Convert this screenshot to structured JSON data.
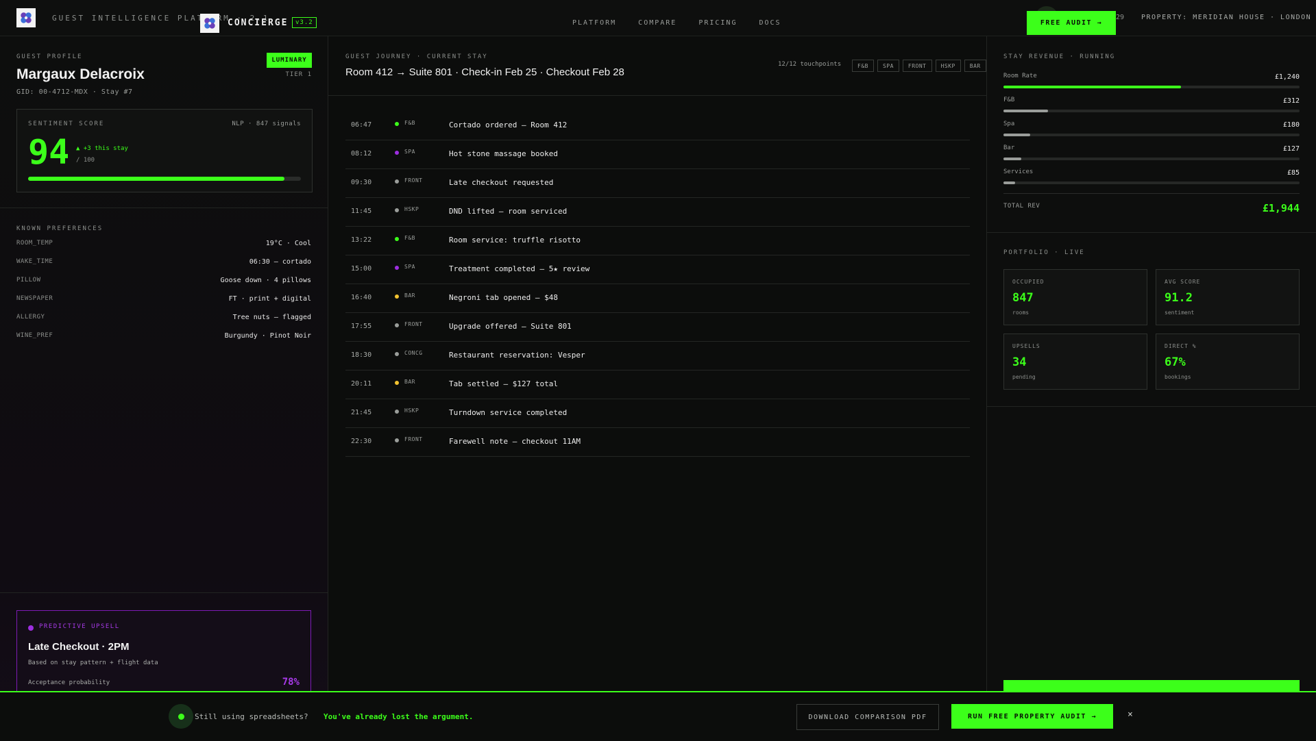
{
  "header": {
    "platform_title": "GUEST INTELLIGENCE PLATFORM · 2.1",
    "brand": "CONCIERGE",
    "version": "v3.2",
    "nav": [
      "PLATFORM",
      "COMPARE",
      "PRICING",
      "DOCS"
    ],
    "partial_number": "29",
    "property": "PROPERTY: MERIDIAN HOUSE · LONDON",
    "cta": "FREE AUDIT →"
  },
  "profile": {
    "eyebrow": "GUEST PROFILE",
    "name": "Margaux Delacroix",
    "gid": "GID: 00-4712-MDX · Stay #7",
    "tier_badge": "LUMINARY",
    "tier": "TIER 1",
    "sentiment": {
      "title": "SENTIMENT SCORE",
      "meta": "NLP · 847 signals",
      "score": "94",
      "delta": "▲ +3 this stay",
      "max": "/ 100",
      "progress": 0.94
    }
  },
  "preferences": {
    "eyebrow": "KNOWN PREFERENCES",
    "items": [
      {
        "key": "ROOM_TEMP",
        "value": "19°C · Cool"
      },
      {
        "key": "WAKE_TIME",
        "value": "06:30 — cortado"
      },
      {
        "key": "PILLOW",
        "value": "Goose down · 4 pillows"
      },
      {
        "key": "NEWSPAPER",
        "value": "FT · print + digital"
      },
      {
        "key": "ALLERGY",
        "value": "Tree nuts — flagged"
      },
      {
        "key": "WINE_PREF",
        "value": "Burgundy · Pinot Noir"
      }
    ]
  },
  "upsell": {
    "tag": "PREDICTIVE UPSELL",
    "title": "Late Checkout · 2PM",
    "desc": "Based on stay pattern + flight data",
    "prob_label": "Acceptance probability",
    "prob": "78%"
  },
  "journey": {
    "eyebrow": "GUEST JOURNEY · CURRENT STAY",
    "route_from": "Room 412",
    "route_arrow": "→",
    "route_to": "Suite 801 · Check-in Feb 25 · Checkout Feb 28",
    "touchpoints": "12/12 touchpoints",
    "filters": [
      "F&B",
      "SPA",
      "FRONT",
      "HSKP",
      "BAR"
    ],
    "category_colors": {
      "F&B": "#3cff1a",
      "SPA": "#9d2ee0",
      "FRONT": "#9a9d9a",
      "HSKP": "#9a9d9a",
      "BAR": "#f2c230",
      "CONCG": "#9a9d9a"
    },
    "events": [
      {
        "time": "06:47",
        "cat": "F&B",
        "text": "Cortado ordered — Room 412"
      },
      {
        "time": "08:12",
        "cat": "SPA",
        "text": "Hot stone massage booked"
      },
      {
        "time": "09:30",
        "cat": "FRONT",
        "text": "Late checkout requested"
      },
      {
        "time": "11:45",
        "cat": "HSKP",
        "text": "DND lifted — room serviced"
      },
      {
        "time": "13:22",
        "cat": "F&B",
        "text": "Room service: truffle risotto"
      },
      {
        "time": "15:00",
        "cat": "SPA",
        "text": "Treatment completed — 5★ review"
      },
      {
        "time": "16:40",
        "cat": "BAR",
        "text": "Negroni tab opened — $48"
      },
      {
        "time": "17:55",
        "cat": "FRONT",
        "text": "Upgrade offered — Suite 801"
      },
      {
        "time": "18:30",
        "cat": "CONCG",
        "text": "Restaurant reservation: Vesper"
      },
      {
        "time": "20:11",
        "cat": "BAR",
        "text": "Tab settled — $127 total"
      },
      {
        "time": "21:45",
        "cat": "HSKP",
        "text": "Turndown service completed"
      },
      {
        "time": "22:30",
        "cat": "FRONT",
        "text": "Farewell note — checkout 11AM"
      }
    ]
  },
  "revenue": {
    "eyebrow": "STAY REVENUE · RUNNING",
    "items": [
      {
        "label": "Room Rate",
        "value": "£1,240",
        "share": 0.6,
        "color": "#3cff1a"
      },
      {
        "label": "F&B",
        "value": "£312",
        "share": 0.15,
        "color": "#9a9d9a"
      },
      {
        "label": "Spa",
        "value": "£180",
        "share": 0.09,
        "color": "#9a9d9a"
      },
      {
        "label": "Bar",
        "value": "£127",
        "share": 0.06,
        "color": "#9a9d9a"
      },
      {
        "label": "Services",
        "value": "£85",
        "share": 0.04,
        "color": "#9a9d9a"
      }
    ],
    "total_label": "TOTAL REV",
    "total": "£1,944"
  },
  "portfolio": {
    "eyebrow": "PORTFOLIO · LIVE",
    "kpis": [
      {
        "label": "OCCUPIED",
        "value": "847",
        "unit": "rooms"
      },
      {
        "label": "AVG SCORE",
        "value": "91.2",
        "unit": "sentiment"
      },
      {
        "label": "UPSELLS",
        "value": "34",
        "unit": "pending"
      },
      {
        "label": "DIRECT %",
        "value": "67%",
        "unit": "bookings"
      }
    ]
  },
  "banner": {
    "text": "Still using spreadsheets?",
    "highlight": "You've already lost the argument.",
    "download": "DOWNLOAD COMPARISON PDF",
    "run_audit": "RUN FREE PROPERTY AUDIT →",
    "close": "×"
  },
  "colors": {
    "accent": "#3cff1a",
    "purple": "#9d2ee0",
    "amber": "#f2c230"
  }
}
